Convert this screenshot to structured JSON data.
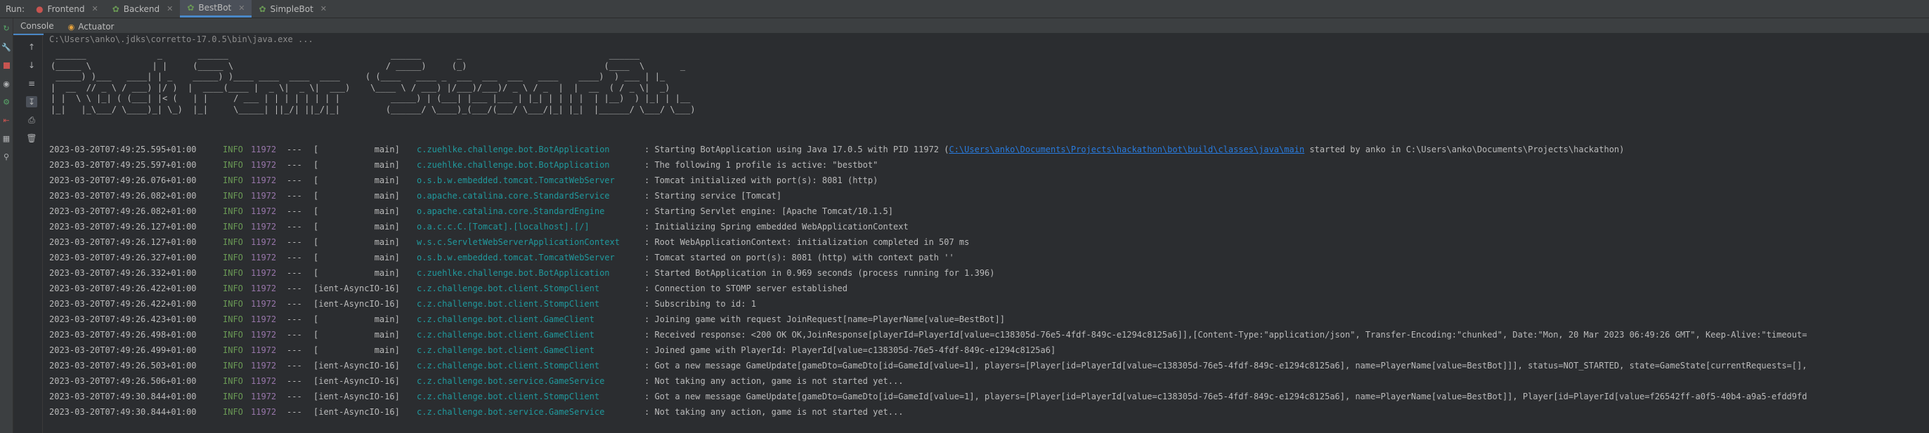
{
  "run_bar": {
    "label": "Run:",
    "tabs": [
      {
        "label": "Frontend"
      },
      {
        "label": "Backend"
      },
      {
        "label": "BestBot"
      },
      {
        "label": "SimpleBot"
      }
    ],
    "active_tab": "BestBot"
  },
  "sub_tabs": [
    {
      "label": "Console"
    },
    {
      "label": "Actuator"
    }
  ],
  "console": {
    "command_line": "C:\\Users\\anko\\.jdks\\corretto-17.0.5\\bin\\java.exe ...",
    "banner": [
      " ______              _       ______                                ______       _                             ______",
      "(_____ \\            | |     (_____ \\                              / _____)     (_)                           (____  \\       _",
      " _____) )___   ____| | _    _____) )____ ____  ____  ____     ( (____   ____ _  ___  ___  ___   ____    ____)  ) ___ | |_",
      "|  __  // _ \\ / ___) |/ )  |  ____(____ |  _ \\|  _ \\|  ___)    \\____ \\ / ___) |/___)/___)/ _ \\ / _  |  |  __  ( / _ \\|  _)",
      "| |  \\ \\ |_| ( (___| |< (   | |     / ___ | | | | | | | |          _____) | (___| |___ |___ | |_| | | | |  | |__)  ) |_| | |__",
      "|_|   |_\\___/ \\____)_| \\_)  |_|     \\_____| ||_/| ||_/|_|         (______/ \\____)_(___/(___/ \\___/|_| |_|  |______/ \\___/ \\___)"
    ],
    "log_lines": [
      {
        "ts": "2023-03-20T07:49:25.595+01:00",
        "level": "INFO",
        "pid": "11972",
        "sep": "---",
        "thread": "[           main]",
        "logger": "c.zuehlke.challenge.bot.BotApplication",
        "msg_pre": ": Starting BotApplication using Java 17.0.5 with PID 11972 (",
        "link": "C:\\Users\\anko\\Documents\\Projects\\hackathon\\bot\\build\\classes\\java\\main",
        "msg_post": " started by anko in C:\\Users\\anko\\Documents\\Projects\\hackathon)"
      },
      {
        "ts": "2023-03-20T07:49:25.597+01:00",
        "level": "INFO",
        "pid": "11972",
        "sep": "---",
        "thread": "[           main]",
        "logger": "c.zuehlke.challenge.bot.BotApplication",
        "msg_pre": ": The following 1 profile is active: \"bestbot\"",
        "link": "",
        "msg_post": ""
      },
      {
        "ts": "2023-03-20T07:49:26.076+01:00",
        "level": "INFO",
        "pid": "11972",
        "sep": "---",
        "thread": "[           main]",
        "logger": "o.s.b.w.embedded.tomcat.TomcatWebServer",
        "msg_pre": ": Tomcat initialized with port(s): 8081 (http)",
        "link": "",
        "msg_post": ""
      },
      {
        "ts": "2023-03-20T07:49:26.082+01:00",
        "level": "INFO",
        "pid": "11972",
        "sep": "---",
        "thread": "[           main]",
        "logger": "o.apache.catalina.core.StandardService",
        "msg_pre": ": Starting service [Tomcat]",
        "link": "",
        "msg_post": ""
      },
      {
        "ts": "2023-03-20T07:49:26.082+01:00",
        "level": "INFO",
        "pid": "11972",
        "sep": "---",
        "thread": "[           main]",
        "logger": "o.apache.catalina.core.StandardEngine",
        "msg_pre": ": Starting Servlet engine: [Apache Tomcat/10.1.5]",
        "link": "",
        "msg_post": ""
      },
      {
        "ts": "2023-03-20T07:49:26.127+01:00",
        "level": "INFO",
        "pid": "11972",
        "sep": "---",
        "thread": "[           main]",
        "logger": "o.a.c.c.C.[Tomcat].[localhost].[/]",
        "msg_pre": ": Initializing Spring embedded WebApplicationContext",
        "link": "",
        "msg_post": ""
      },
      {
        "ts": "2023-03-20T07:49:26.127+01:00",
        "level": "INFO",
        "pid": "11972",
        "sep": "---",
        "thread": "[           main]",
        "logger": "w.s.c.ServletWebServerApplicationContext",
        "msg_pre": ": Root WebApplicationContext: initialization completed in 507 ms",
        "link": "",
        "msg_post": ""
      },
      {
        "ts": "2023-03-20T07:49:26.327+01:00",
        "level": "INFO",
        "pid": "11972",
        "sep": "---",
        "thread": "[           main]",
        "logger": "o.s.b.w.embedded.tomcat.TomcatWebServer",
        "msg_pre": ": Tomcat started on port(s): 8081 (http) with context path ''",
        "link": "",
        "msg_post": ""
      },
      {
        "ts": "2023-03-20T07:49:26.332+01:00",
        "level": "INFO",
        "pid": "11972",
        "sep": "---",
        "thread": "[           main]",
        "logger": "c.zuehlke.challenge.bot.BotApplication",
        "msg_pre": ": Started BotApplication in 0.969 seconds (process running for 1.396)",
        "link": "",
        "msg_post": ""
      },
      {
        "ts": "2023-03-20T07:49:26.422+01:00",
        "level": "INFO",
        "pid": "11972",
        "sep": "---",
        "thread": "[ient-AsyncIO-16]",
        "logger": "c.z.challenge.bot.client.StompClient",
        "msg_pre": ": Connection to STOMP server established",
        "link": "",
        "msg_post": ""
      },
      {
        "ts": "2023-03-20T07:49:26.422+01:00",
        "level": "INFO",
        "pid": "11972",
        "sep": "---",
        "thread": "[ient-AsyncIO-16]",
        "logger": "c.z.challenge.bot.client.StompClient",
        "msg_pre": ": Subscribing to id: 1",
        "link": "",
        "msg_post": ""
      },
      {
        "ts": "2023-03-20T07:49:26.423+01:00",
        "level": "INFO",
        "pid": "11972",
        "sep": "---",
        "thread": "[           main]",
        "logger": "c.z.challenge.bot.client.GameClient",
        "msg_pre": ": Joining game with request JoinRequest[name=PlayerName[value=BestBot]]",
        "link": "",
        "msg_post": ""
      },
      {
        "ts": "2023-03-20T07:49:26.498+01:00",
        "level": "INFO",
        "pid": "11972",
        "sep": "---",
        "thread": "[           main]",
        "logger": "c.z.challenge.bot.client.GameClient",
        "msg_pre": ": Received response: <200 OK OK,JoinResponse[playerId=PlayerId[value=c138305d-76e5-4fdf-849c-e1294c8125a6]],[Content-Type:\"application/json\", Transfer-Encoding:\"chunked\", Date:\"Mon, 20 Mar 2023 06:49:26 GMT\", Keep-Alive:\"timeout=",
        "link": "",
        "msg_post": ""
      },
      {
        "ts": "2023-03-20T07:49:26.499+01:00",
        "level": "INFO",
        "pid": "11972",
        "sep": "---",
        "thread": "[           main]",
        "logger": "c.z.challenge.bot.client.GameClient",
        "msg_pre": ": Joined game with PlayerId: PlayerId[value=c138305d-76e5-4fdf-849c-e1294c8125a6]",
        "link": "",
        "msg_post": ""
      },
      {
        "ts": "2023-03-20T07:49:26.503+01:00",
        "level": "INFO",
        "pid": "11972",
        "sep": "---",
        "thread": "[ient-AsyncIO-16]",
        "logger": "c.z.challenge.bot.client.StompClient",
        "msg_pre": ": Got a new message GameUpdate[gameDto=GameDto[id=GameId[value=1], players=[Player[id=PlayerId[value=c138305d-76e5-4fdf-849c-e1294c8125a6], name=PlayerName[value=BestBot]]], status=NOT_STARTED, state=GameState[currentRequests=[],",
        "link": "",
        "msg_post": ""
      },
      {
        "ts": "2023-03-20T07:49:26.506+01:00",
        "level": "INFO",
        "pid": "11972",
        "sep": "---",
        "thread": "[ient-AsyncIO-16]",
        "logger": "c.z.challenge.bot.service.GameService",
        "msg_pre": ": Not taking any action, game is not started yet...",
        "link": "",
        "msg_post": ""
      },
      {
        "ts": "2023-03-20T07:49:30.844+01:00",
        "level": "INFO",
        "pid": "11972",
        "sep": "---",
        "thread": "[ient-AsyncIO-16]",
        "logger": "c.z.challenge.bot.client.StompClient",
        "msg_pre": ": Got a new message GameUpdate[gameDto=GameDto[id=GameId[value=1], players=[Player[id=PlayerId[value=c138305d-76e5-4fdf-849c-e1294c8125a6], name=PlayerName[value=BestBot]], Player[id=PlayerId[value=f26542ff-a0f5-40b4-a9a5-efdd9fd",
        "link": "",
        "msg_post": ""
      },
      {
        "ts": "2023-03-20T07:49:30.844+01:00",
        "level": "INFO",
        "pid": "11972",
        "sep": "---",
        "thread": "[ient-AsyncIO-16]",
        "logger": "c.z.challenge.bot.service.GameService",
        "msg_pre": ": Not taking any action, game is not started yet...",
        "link": "",
        "msg_post": ""
      }
    ]
  },
  "colors": {
    "background": "#2b2d30",
    "level_info": "#6a9955",
    "pid": "#9876aa",
    "logger": "#20999d",
    "link": "#287bde",
    "accent": "#4a88c7"
  },
  "icons": {
    "left_strip": [
      "rerun-icon",
      "wrench-icon",
      "stop-icon",
      "camera-icon",
      "debug-icon",
      "exit-icon",
      "layout-icon",
      "pin-icon"
    ],
    "console_strip": [
      "arrow-up-icon",
      "arrow-down-icon",
      "soft-wrap-icon",
      "scroll-to-end-icon",
      "print-icon",
      "trash-icon"
    ]
  }
}
